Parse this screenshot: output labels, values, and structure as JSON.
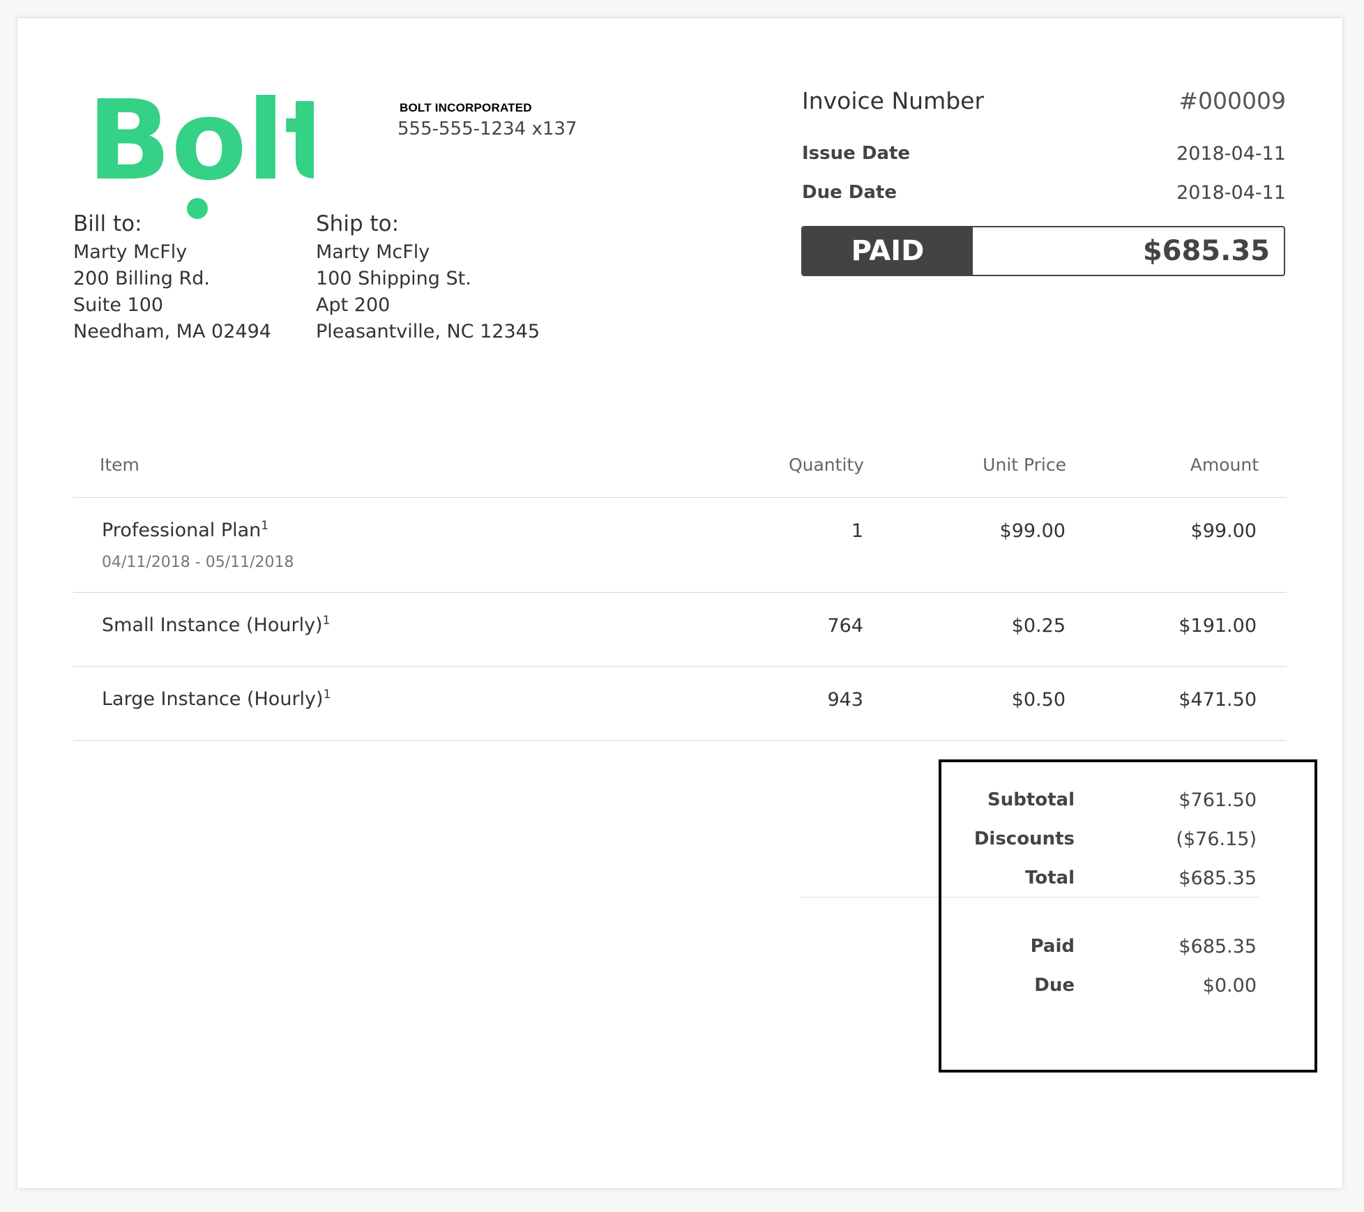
{
  "company": {
    "logo_text": "Bolt",
    "name": "BOLT INCORPORATED",
    "phone": "555-555-1234 x137",
    "brand_color": "#34d186"
  },
  "invoice": {
    "number_label": "Invoice Number",
    "number": "#000009",
    "issue_date_label": "Issue Date",
    "issue_date": "2018-04-11",
    "due_date_label": "Due Date",
    "due_date": "2018-04-11",
    "status": "PAID",
    "amount": "$685.35"
  },
  "bill_to": {
    "heading": "Bill to:",
    "lines": [
      "Marty McFly",
      "200 Billing Rd.",
      "Suite 100",
      "Needham, MA 02494"
    ]
  },
  "ship_to": {
    "heading": "Ship to:",
    "lines": [
      "Marty McFly",
      "100 Shipping St.",
      "Apt 200",
      "Pleasantville, NC 12345"
    ]
  },
  "table": {
    "headers": [
      "Item",
      "Quantity",
      "Unit Price",
      "Amount"
    ],
    "rows": [
      {
        "item": "Professional Plan",
        "note": "1",
        "period": "04/11/2018 - 05/11/2018",
        "quantity": "1",
        "unit_price": "$99.00",
        "amount": "$99.00"
      },
      {
        "item": "Small Instance (Hourly)",
        "note": "1",
        "quantity": "764",
        "unit_price": "$0.25",
        "amount": "$191.00"
      },
      {
        "item": "Large Instance (Hourly)",
        "note": "1",
        "quantity": "943",
        "unit_price": "$0.50",
        "amount": "$471.50"
      }
    ]
  },
  "summary": {
    "subtotal_label": "Subtotal",
    "subtotal": "$761.50",
    "discounts_label": "Discounts",
    "discounts": "($76.15)",
    "total_label": "Total",
    "total": "$685.35",
    "paid_label": "Paid",
    "paid": "$685.35",
    "due_label": "Due",
    "due": "$0.00"
  }
}
